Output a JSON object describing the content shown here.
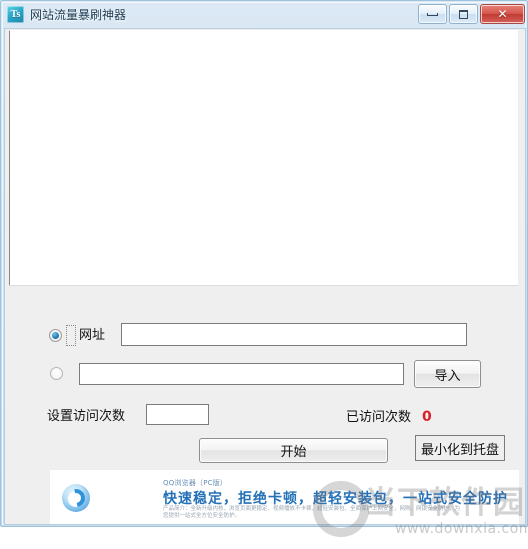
{
  "window": {
    "title": "网站流量暴刷神器",
    "app_icon": "app-icon",
    "icon_glyph": "Ts",
    "buttons": {
      "minimize": "minimize",
      "maximize": "maximize",
      "close": "✕"
    }
  },
  "form": {
    "url_radio_label": "网址",
    "url_input_value": "",
    "url_input_placeholder": "",
    "file_input_value": "",
    "file_input_placeholder": "",
    "import_button": "导入",
    "visit_count_label": "设置访问次数",
    "visit_count_value": "",
    "visited_count_label": "已访问次数",
    "visited_count_value": "0",
    "visited_count_color": "#d8202a",
    "start_button": "开始",
    "minimize_tray_button": "最小化到托盘"
  },
  "ad": {
    "kicker": "QQ浏览器（PC版）",
    "headline": "快速稳定，拒绝卡顿，超轻安装包，一站式安全防护",
    "subtext": "产品简介：全新升级内核，浏览页面更稳定、视频播放不卡顿、超轻安装包、全面保护上网安全，网购、网银安全防护，为您提供一站式全方位安全防护。"
  },
  "watermark": {
    "name": "当下软件园",
    "url": "www.downxia.com"
  }
}
